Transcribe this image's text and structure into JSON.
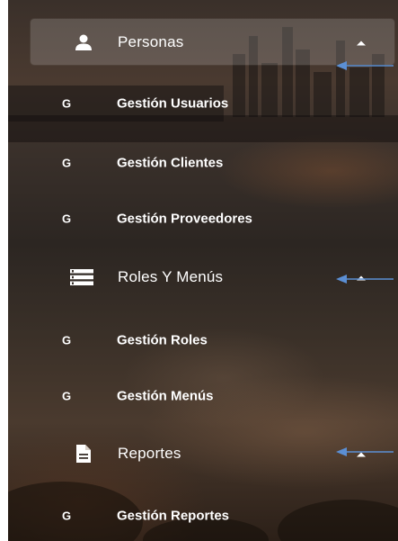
{
  "menu": {
    "groups": [
      {
        "label": "Personas",
        "icon": "user-icon",
        "expanded": true,
        "items": [
          {
            "prefix": "G",
            "label": "Gestión Usuarios"
          },
          {
            "prefix": "G",
            "label": "Gestión Clientes"
          },
          {
            "prefix": "G",
            "label": "Gestión Proveedores"
          }
        ]
      },
      {
        "label": "Roles Y Menús",
        "icon": "list-icon",
        "expanded": true,
        "items": [
          {
            "prefix": "G",
            "label": "Gestión Roles"
          },
          {
            "prefix": "G",
            "label": "Gestión Menús"
          }
        ]
      },
      {
        "label": "Reportes",
        "icon": "document-icon",
        "expanded": true,
        "items": [
          {
            "prefix": "G",
            "label": "Gestión Reportes"
          }
        ]
      }
    ]
  },
  "colors": {
    "text": "#ffffff",
    "annotation_arrow": "#5b8fd4",
    "active_highlight": "rgba(255,255,255,0.17)"
  }
}
